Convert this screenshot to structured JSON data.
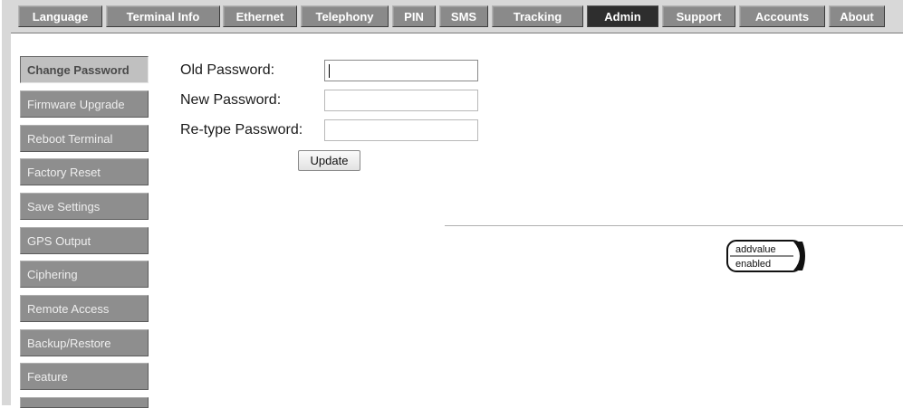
{
  "topnav": {
    "tabs": [
      {
        "label": "Language"
      },
      {
        "label": "Terminal Info"
      },
      {
        "label": "Ethernet"
      },
      {
        "label": "Telephony"
      },
      {
        "label": "PIN"
      },
      {
        "label": "SMS"
      },
      {
        "label": "Tracking"
      },
      {
        "label": "Admin"
      },
      {
        "label": "Support"
      },
      {
        "label": "Accounts"
      },
      {
        "label": "About"
      }
    ],
    "active": "Admin"
  },
  "sidebar": {
    "items": [
      {
        "label": "Change Password"
      },
      {
        "label": "Firmware Upgrade"
      },
      {
        "label": "Reboot Terminal"
      },
      {
        "label": "Factory Reset"
      },
      {
        "label": "Save Settings"
      },
      {
        "label": "GPS Output"
      },
      {
        "label": "Ciphering"
      },
      {
        "label": "Remote Access"
      },
      {
        "label": "Backup/Restore"
      },
      {
        "label": "Feature"
      },
      {
        "label": ""
      }
    ],
    "active": "Change Password"
  },
  "form": {
    "old_label": "Old Password:",
    "old_value": "",
    "new_label": "New Password:",
    "new_value": "",
    "retype_label": "Re-type Password:",
    "retype_value": "",
    "update_label": "Update"
  },
  "logo": {
    "line1": "addvalue",
    "line2": "enabled"
  }
}
